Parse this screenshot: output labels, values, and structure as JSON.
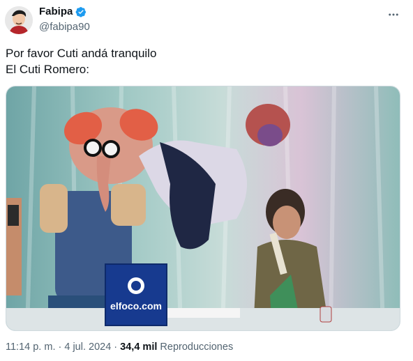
{
  "author": {
    "name": "Fabipa",
    "handle": "@fabipa90",
    "verified": true
  },
  "icons": {
    "avatar": "profile-avatar",
    "verified": "verified-badge-icon",
    "more": "more-options-icon"
  },
  "tweet": {
    "line1": "Por favor Cuti andá tranquilo",
    "line2": "El Cuti Romero:"
  },
  "media": {
    "sign_text": "elfoco.com"
  },
  "meta": {
    "time": "11:14 p. m.",
    "sep1": " · ",
    "date": "4 jul. 2024",
    "sep2": " · ",
    "views_count": "34,4 mil",
    "views_label": " Reproducciones"
  },
  "colors": {
    "accent_verified": "#1d9bf0",
    "text_secondary": "#536471"
  }
}
